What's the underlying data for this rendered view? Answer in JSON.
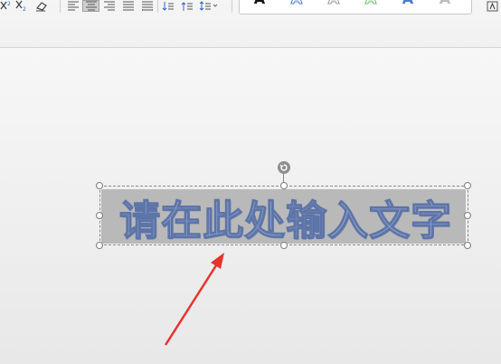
{
  "textbox": {
    "text": "请在此处输入文字",
    "fill_color": "#8ea2cc",
    "outline_color": "#5d74a8",
    "selection_color": "#b9b9b9"
  },
  "ribbon": {
    "icons": [
      "superscript-icon",
      "subscript-icon",
      "clear-formatting-icon",
      "align-left-icon",
      "align-center-icon",
      "align-right-icon",
      "justify-icon",
      "distributed-icon",
      "line-spacing-decrease-icon",
      "line-spacing-increase-icon",
      "line-spacing-icon"
    ],
    "gallery_colors": [
      "#111111",
      "#4a7bd0",
      "#9a9a9a",
      "#6fbf6f",
      "#4a7bd0",
      "#bdbdbd"
    ]
  },
  "annotation": {
    "arrow_color": "#e8322a"
  }
}
